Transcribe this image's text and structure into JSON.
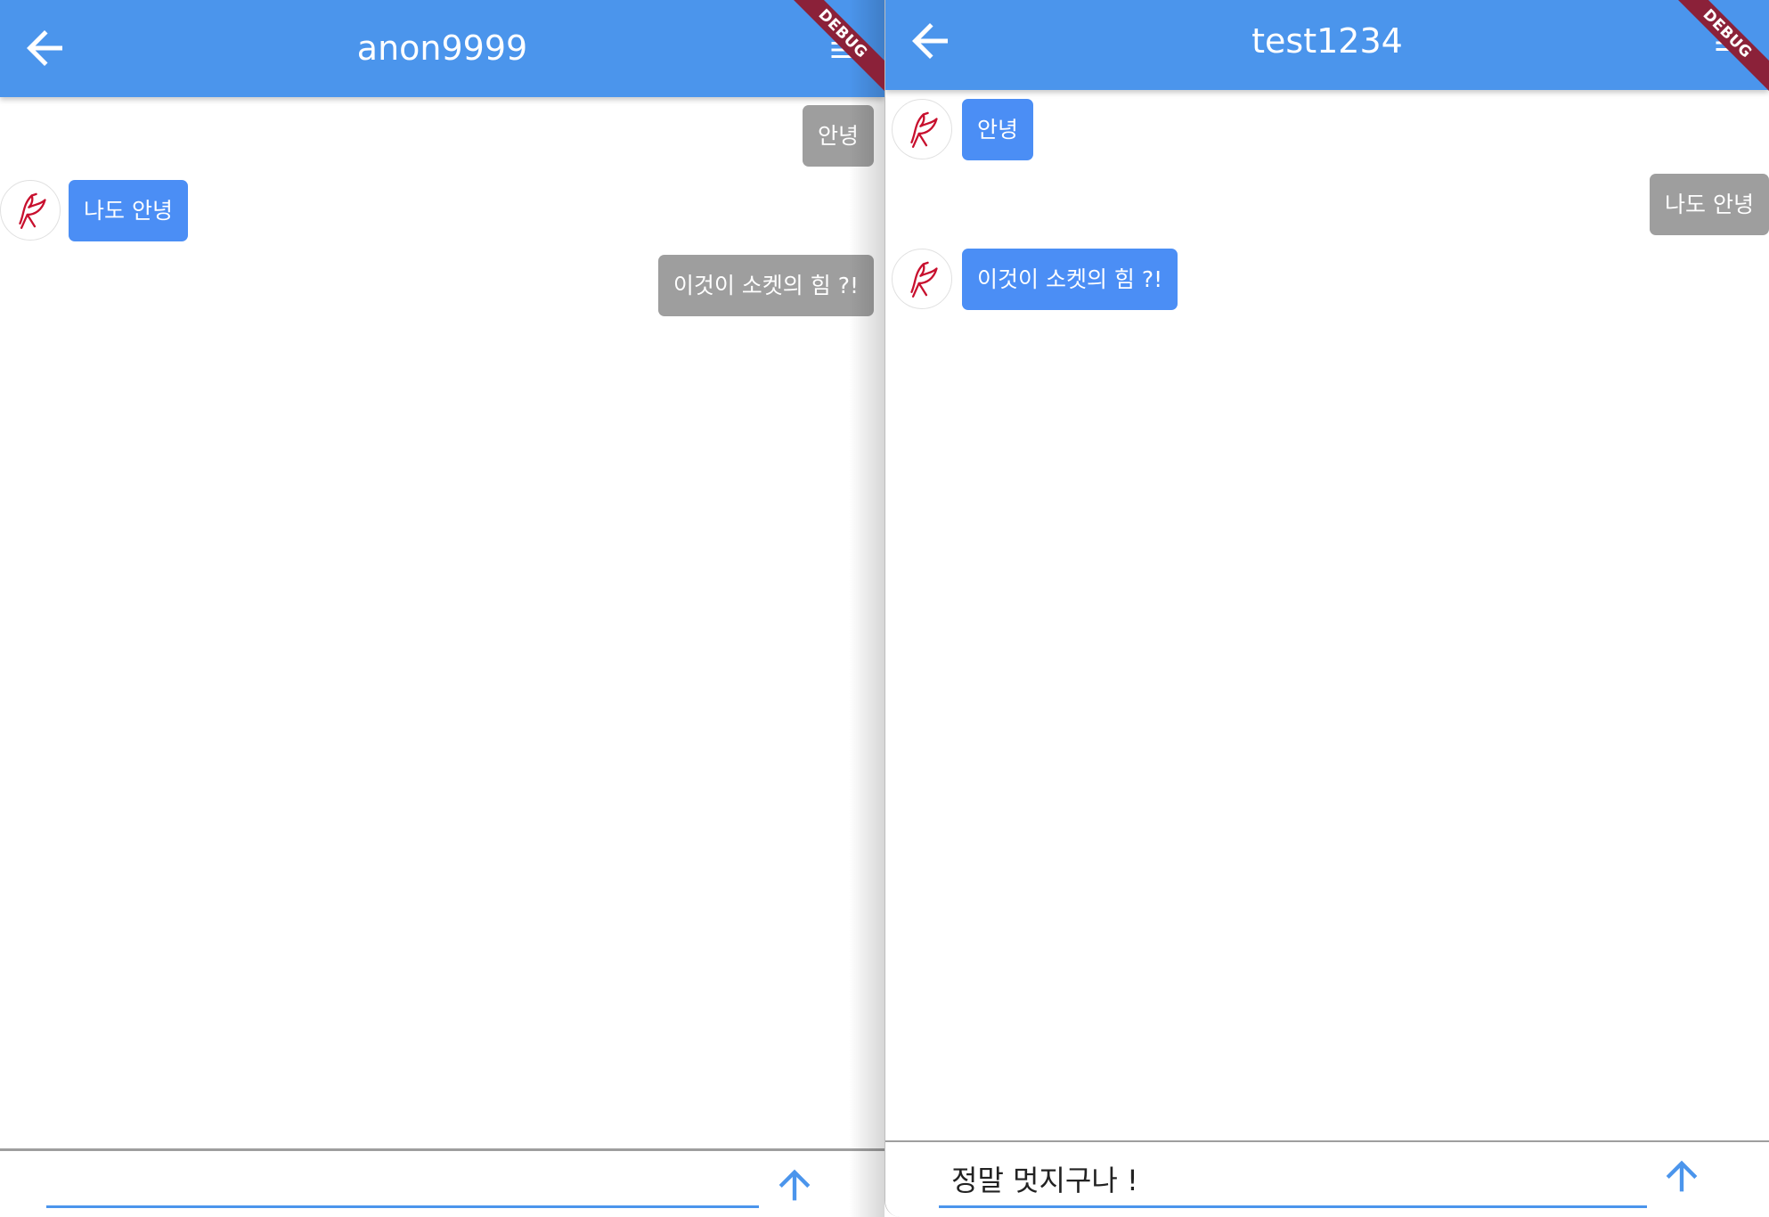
{
  "colors": {
    "app_bar": "#4b95ec",
    "bubble_sent": "#9e9e9e",
    "bubble_received": "#4b8ef5",
    "debug_banner": "#8b2139",
    "input_underline": "#4b95ec"
  },
  "icons": {
    "back": "arrow-left-icon",
    "menu": "menu-icon",
    "send": "arrow-up-icon",
    "avatar": "bird-logo-icon"
  },
  "left": {
    "title": "anon9999",
    "debug_label": "DEBUG",
    "messages": [
      {
        "text": "안녕",
        "from": "me"
      },
      {
        "text": "나도 안녕",
        "from": "them"
      },
      {
        "text": "이것이 소켓의 힘 ?!",
        "from": "me"
      }
    ],
    "input": {
      "value": ""
    }
  },
  "right": {
    "title": "test1234",
    "debug_label": "DEBUG",
    "messages": [
      {
        "text": "안녕",
        "from": "them"
      },
      {
        "text": "나도 안녕",
        "from": "me"
      },
      {
        "text": "이것이 소켓의 힘 ?!",
        "from": "them"
      }
    ],
    "input": {
      "value": "정말 멋지구나 !"
    }
  }
}
